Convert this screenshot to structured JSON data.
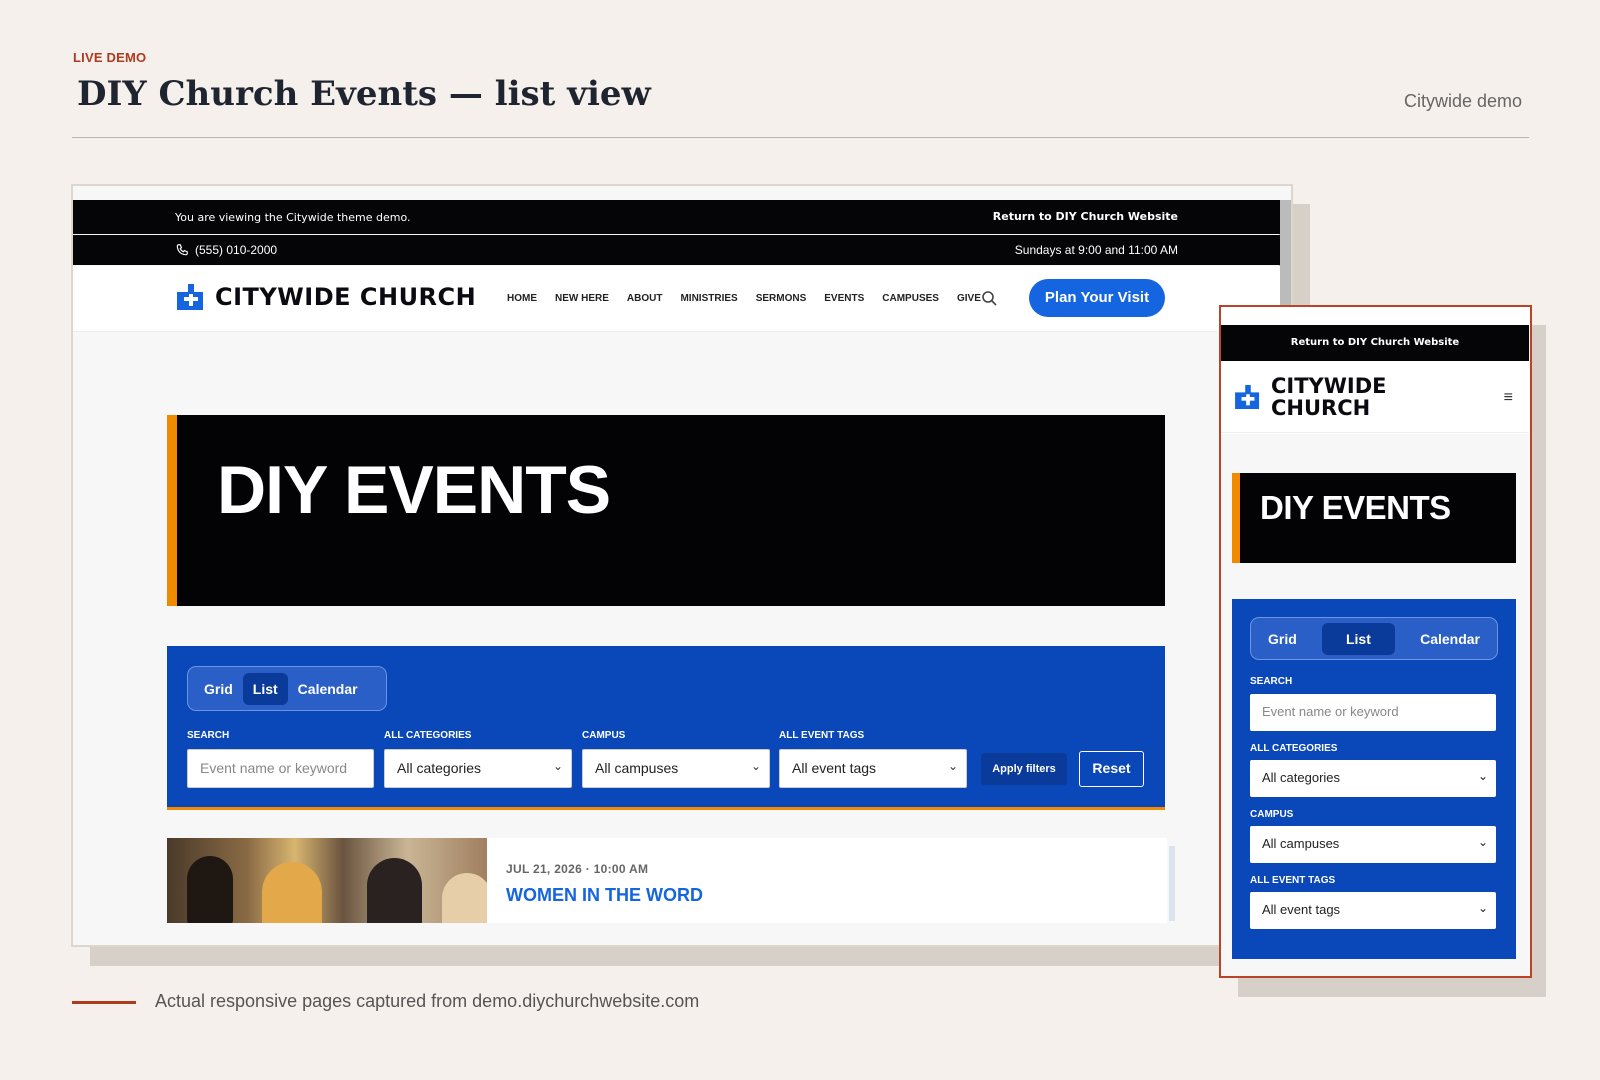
{
  "slide": {
    "kicker": "LIVE DEMO",
    "title": "DIY Church Events — list view",
    "subtitle": "Citywide demo",
    "caption": "Actual responsive pages captured from demo.diychurchwebsite.com"
  },
  "desktop": {
    "top_bar": {
      "notice": "You are viewing the Citywide theme demo.",
      "return_link": "Return to DIY Church Website"
    },
    "info_bar": {
      "phone": "(555) 010-2000",
      "service_times": "Sundays at 9:00 and 11:00 AM"
    },
    "brand": "CITYWIDE CHURCH",
    "menu": [
      "HOME",
      "NEW HERE",
      "ABOUT",
      "MINISTRIES",
      "SERMONS",
      "EVENTS",
      "CAMPUSES",
      "GIVE"
    ],
    "cta": "Plan Your Visit",
    "hero_title": "DIY EVENTS",
    "view_tabs": [
      "Grid",
      "List",
      "Calendar"
    ],
    "active_tab": "List",
    "filters": {
      "search_label": "SEARCH",
      "search_placeholder": "Event name or keyword",
      "categories_label": "ALL CATEGORIES",
      "categories_value": "All categories",
      "campus_label": "CAMPUS",
      "campus_value": "All campuses",
      "tags_label": "ALL EVENT TAGS",
      "tags_value": "All event tags",
      "apply": "Apply filters",
      "reset": "Reset"
    },
    "event": {
      "date": "JUL 21, 2026 · 10:00 AM",
      "title": "WOMEN IN THE WORD"
    }
  },
  "mobile": {
    "return_link": "Return to DIY Church Website",
    "brand_line1": "CITYWIDE",
    "brand_line2": "CHURCH",
    "hero_title": "DIY EVENTS",
    "view_tabs": [
      "Grid",
      "List",
      "Calendar"
    ],
    "search_label": "SEARCH",
    "search_placeholder": "Event name or keyword",
    "categories_label": "ALL CATEGORIES",
    "categories_value": "All categories",
    "campus_label": "CAMPUS",
    "campus_value": "All campuses",
    "tags_label": "ALL EVENT TAGS",
    "tags_value": "All event tags"
  },
  "colors": {
    "accent": "#b03a1f",
    "brand_blue": "#1565e0",
    "filter_blue": "#0a47b8",
    "hero_bar": "#f08b00"
  },
  "icons": {
    "phone": "phone-icon",
    "search": "search-icon",
    "logo": "cross-logo-icon",
    "menu": "hamburger-icon",
    "chevron": "chevron-down-icon"
  }
}
